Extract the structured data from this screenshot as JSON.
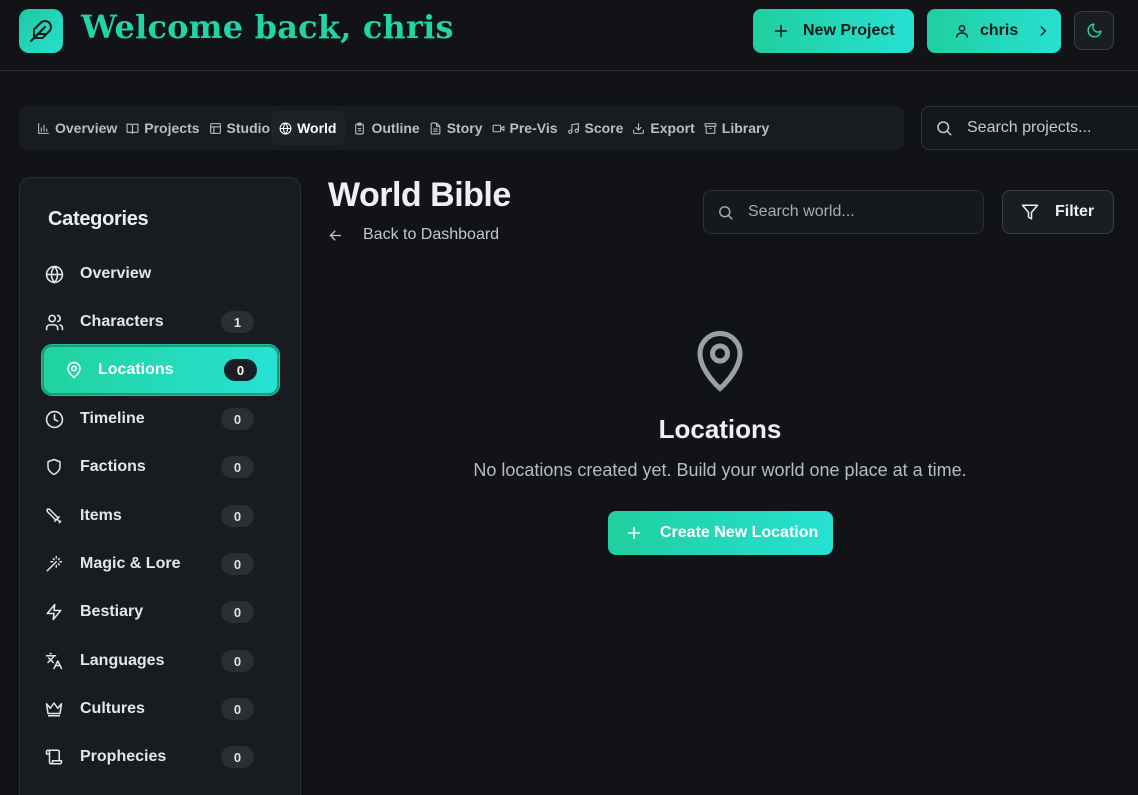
{
  "header": {
    "welcome": "Welcome back, chris",
    "new_project_label": "New Project",
    "user_label": "chris"
  },
  "nav": {
    "tabs": [
      {
        "label": "Overview",
        "icon": "bar-chart-icon"
      },
      {
        "label": "Projects",
        "icon": "book-icon"
      },
      {
        "label": "Studio",
        "icon": "layout-icon"
      },
      {
        "label": "World",
        "icon": "globe-icon",
        "active": true
      },
      {
        "label": "Outline",
        "icon": "clipboard-icon"
      },
      {
        "label": "Story",
        "icon": "file-text-icon"
      },
      {
        "label": "Pre-Vis",
        "icon": "video-icon"
      },
      {
        "label": "Score",
        "icon": "music-icon"
      },
      {
        "label": "Export",
        "icon": "download-icon"
      },
      {
        "label": "Library",
        "icon": "archive-icon"
      }
    ],
    "search_placeholder": "Search projects..."
  },
  "sidebar": {
    "title": "Categories",
    "items": [
      {
        "label": "Overview",
        "icon": "globe-icon"
      },
      {
        "label": "Characters",
        "icon": "users-icon",
        "count": "1"
      },
      {
        "label": "Locations",
        "icon": "map-pin-icon",
        "count": "0",
        "active": true
      },
      {
        "label": "Timeline",
        "icon": "clock-icon",
        "count": "0"
      },
      {
        "label": "Factions",
        "icon": "shield-icon",
        "count": "0"
      },
      {
        "label": "Items",
        "icon": "sword-icon",
        "count": "0"
      },
      {
        "label": "Magic & Lore",
        "icon": "wand-icon",
        "count": "0"
      },
      {
        "label": "Bestiary",
        "icon": "zap-icon",
        "count": "0"
      },
      {
        "label": "Languages",
        "icon": "languages-icon",
        "count": "0"
      },
      {
        "label": "Cultures",
        "icon": "crown-icon",
        "count": "0"
      },
      {
        "label": "Prophecies",
        "icon": "scroll-icon",
        "count": "0"
      }
    ]
  },
  "main": {
    "title": "World Bible",
    "back_label": "Back to Dashboard",
    "search_placeholder": "Search world...",
    "filter_label": "Filter",
    "empty": {
      "title": "Locations",
      "description": "No locations created yet. Build your world one place at a time.",
      "button_label": "Create New Location"
    }
  },
  "colors": {
    "accent": "#22d3a5",
    "accent_end": "#27e0d2",
    "background": "#111317",
    "panel": "#181b20"
  }
}
